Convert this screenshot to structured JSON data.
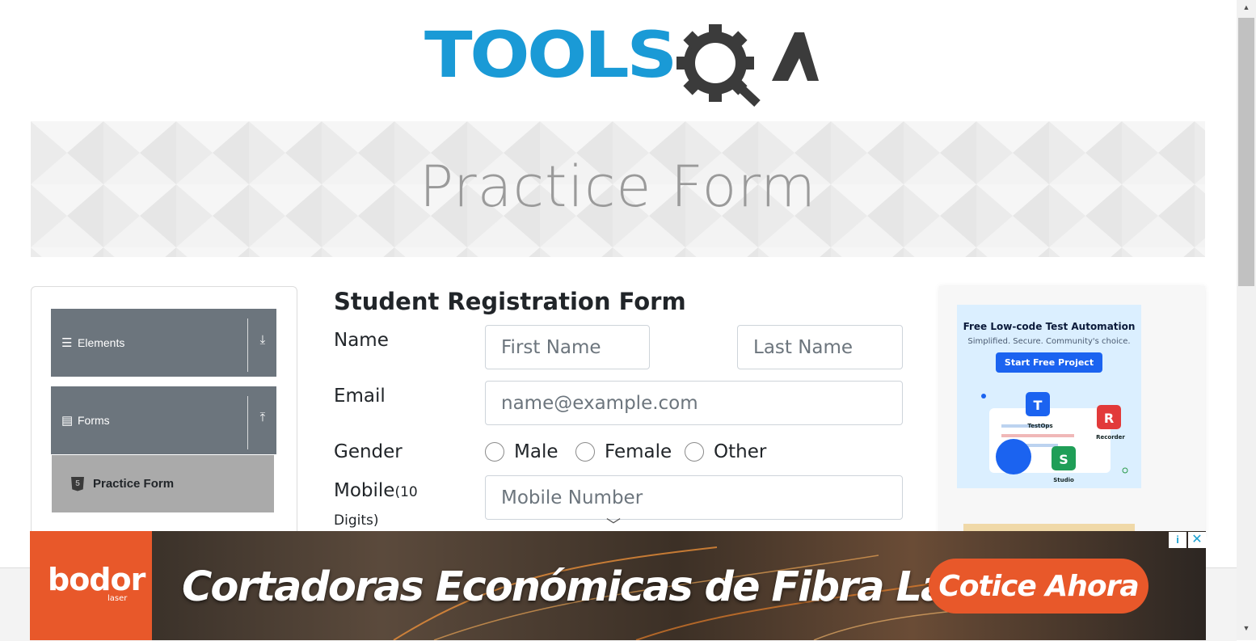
{
  "logo": {
    "text_tools": "TOOLS",
    "text_qa": "QA"
  },
  "banner": {
    "title": "Practice Form"
  },
  "sidebar": {
    "groups": [
      {
        "label": "Elements",
        "icon": "hamburger-icon",
        "arrow_icon": "download-arrow-icon"
      },
      {
        "label": "Forms",
        "icon": "document-icon",
        "arrow_icon": "upload-arrow-icon"
      }
    ],
    "active_item": {
      "label": "Practice Form",
      "icon": "html5-icon"
    }
  },
  "form": {
    "title": "Student Registration Form",
    "name_label": "Name",
    "first_name_placeholder": "First Name",
    "last_name_placeholder": "Last Name",
    "email_label": "Email",
    "email_placeholder": "name@example.com",
    "gender_label": "Gender",
    "gender_options": [
      "Male",
      "Female",
      "Other"
    ],
    "mobile_label": "Mobile",
    "mobile_hint_a": "(10",
    "mobile_hint_b": "Digits)",
    "mobile_placeholder": "Mobile Number"
  },
  "ad_right": {
    "headline": "Free Low-code Test Automation",
    "subline": "Simplified. Secure. Community's choice.",
    "button": "Start Free Project",
    "labels": [
      "TestOps",
      "Recorder",
      "Studio"
    ],
    "badges": [
      "T",
      "R",
      "S"
    ]
  },
  "ad_bottom": {
    "brand": "bodor",
    "brand_sub": "laser",
    "headline": "Cortadoras Económicas de Fibra Láser",
    "cta": "Cotice Ahora",
    "adchoice": "i",
    "close": "✕"
  },
  "colors": {
    "tools_blue": "#1a9ad6",
    "qa_dark": "#3b3b3b",
    "sidebar_gray": "#6c757d",
    "ad_orange": "#e8582a",
    "ad_button_blue": "#1b63f0"
  }
}
